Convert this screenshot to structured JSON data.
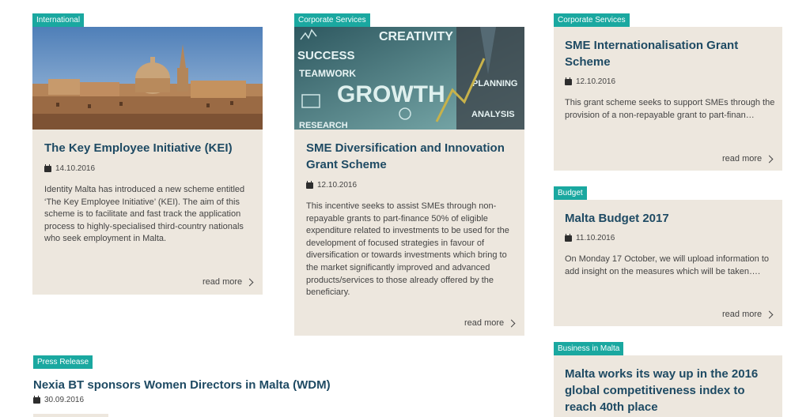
{
  "cards": [
    {
      "tag": "International",
      "title": "The Key Employee Initiative (KEI)",
      "date": "14.10.2016",
      "desc": "Identity Malta has introduced a new scheme entitled ‘The Key Employee Initiative’ (KEI). The aim of this scheme is to facilitate and fast track the application process to highly-specialised third-country nationals who seek employment in Malta.",
      "more": "read more"
    },
    {
      "tag": "Corporate Services",
      "title": "SME Diversification and Innovation Grant Scheme",
      "date": "12.10.2016",
      "desc": "This incentive seeks to assist SMEs through non-repayable grants to part-finance 50% of eligible expenditure related to investments to be used for the development of focused strategies in favour of diversification or towards investments which bring to the market significantly improved and advanced products/services to those already offered by the beneficiary.",
      "more": "read more",
      "image_words": [
        "CREATIVITY",
        "SUCCESS",
        "TEAMWORK",
        "GROWTH",
        "PLANNING",
        "ANALYSIS",
        "RESEARCH"
      ]
    },
    {
      "tag": "Corporate Services",
      "title": "SME Internationalisation Grant Scheme",
      "date": "12.10.2016",
      "desc": "This grant scheme seeks to support SMEs through the provision of a non-repayable grant to part-finan…",
      "more": "read more"
    },
    {
      "tag": "Budget",
      "title": "Malta Budget 2017",
      "date": "11.10.2016",
      "desc": "On Monday 17 October, we will upload information to add insight on the measures which will be taken….",
      "more": "read more"
    },
    {
      "tag": "Business in Malta",
      "title": "Malta works its way up in the 2016 global competitiveness index to reach 40th place"
    },
    {
      "tag": "Press Release",
      "title": "Nexia BT sponsors Women Directors in Malta (WDM)",
      "date": "30.09.2016"
    }
  ],
  "colors": {
    "tag_bg": "#1aa8a0",
    "card_bg": "#ede7de",
    "title": "#1e4a63"
  }
}
